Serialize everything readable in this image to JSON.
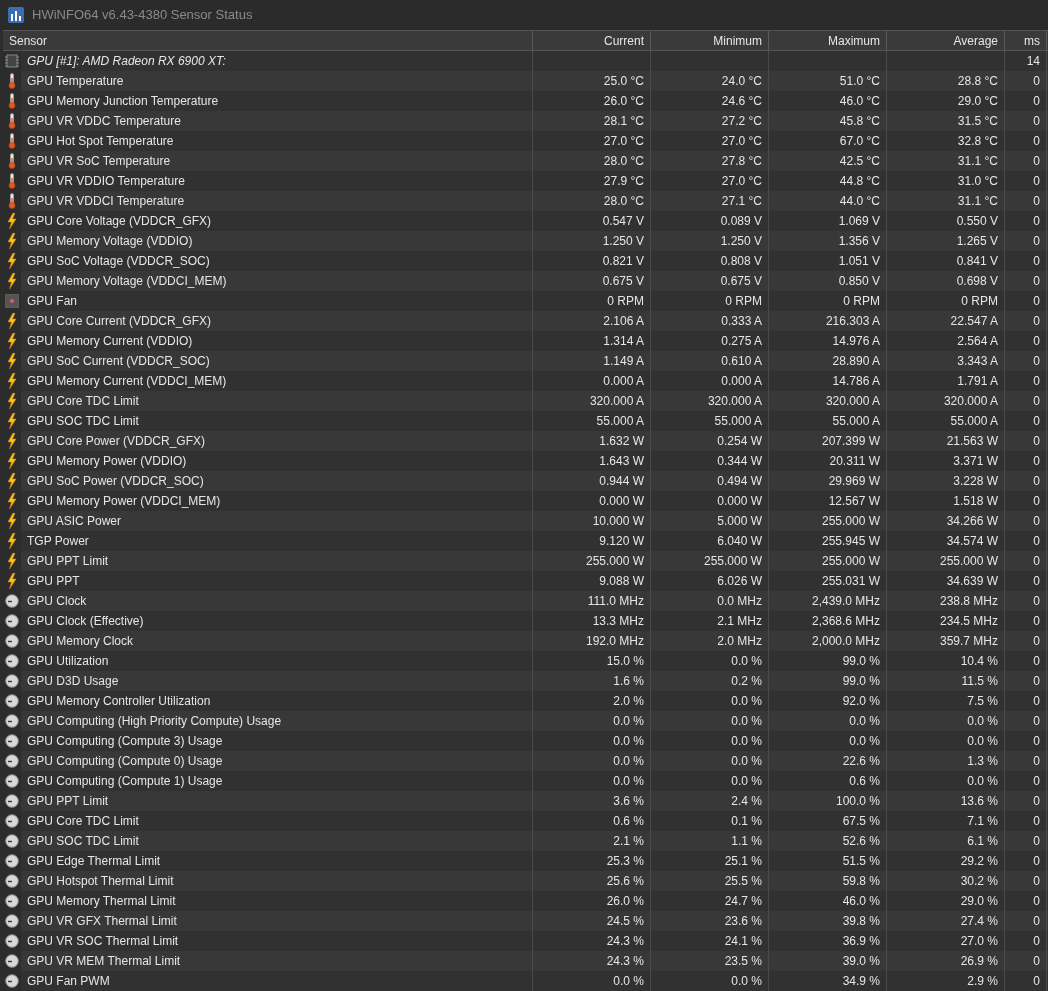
{
  "window": {
    "title": "HWiNFO64 v6.43-4380 Sensor Status"
  },
  "columns": [
    "Sensor",
    "Current",
    "Minimum",
    "Maximum",
    "Average",
    "ms"
  ],
  "rows": [
    {
      "kind": "device",
      "sensor": "GPU [#1]: AMD Radeon RX 6900 XT:",
      "current": "",
      "minimum": "",
      "maximum": "",
      "average": "",
      "ms": "14"
    },
    {
      "kind": "temperature",
      "sensor": "GPU Temperature",
      "current": "25.0 °C",
      "minimum": "24.0 °C",
      "maximum": "51.0 °C",
      "average": "28.8 °C",
      "ms": "0"
    },
    {
      "kind": "temperature",
      "sensor": "GPU Memory Junction Temperature",
      "current": "26.0 °C",
      "minimum": "24.6 °C",
      "maximum": "46.0 °C",
      "average": "29.0 °C",
      "ms": "0"
    },
    {
      "kind": "temperature",
      "sensor": "GPU VR VDDC Temperature",
      "current": "28.1 °C",
      "minimum": "27.2 °C",
      "maximum": "45.8 °C",
      "average": "31.5 °C",
      "ms": "0"
    },
    {
      "kind": "temperature",
      "sensor": "GPU Hot Spot Temperature",
      "current": "27.0 °C",
      "minimum": "27.0 °C",
      "maximum": "67.0 °C",
      "average": "32.8 °C",
      "ms": "0"
    },
    {
      "kind": "temperature",
      "sensor": "GPU VR SoC Temperature",
      "current": "28.0 °C",
      "minimum": "27.8 °C",
      "maximum": "42.5 °C",
      "average": "31.1 °C",
      "ms": "0"
    },
    {
      "kind": "temperature",
      "sensor": "GPU VR VDDIO Temperature",
      "current": "27.9 °C",
      "minimum": "27.0 °C",
      "maximum": "44.8 °C",
      "average": "31.0 °C",
      "ms": "0"
    },
    {
      "kind": "temperature",
      "sensor": "GPU VR VDDCI Temperature",
      "current": "28.0 °C",
      "minimum": "27.1 °C",
      "maximum": "44.0 °C",
      "average": "31.1 °C",
      "ms": "0"
    },
    {
      "kind": "electrical",
      "sensor": "GPU Core Voltage (VDDCR_GFX)",
      "current": "0.547 V",
      "minimum": "0.089 V",
      "maximum": "1.069 V",
      "average": "0.550 V",
      "ms": "0"
    },
    {
      "kind": "electrical",
      "sensor": "GPU Memory Voltage (VDDIO)",
      "current": "1.250 V",
      "minimum": "1.250 V",
      "maximum": "1.356 V",
      "average": "1.265 V",
      "ms": "0"
    },
    {
      "kind": "electrical",
      "sensor": "GPU SoC Voltage (VDDCR_SOC)",
      "current": "0.821 V",
      "minimum": "0.808 V",
      "maximum": "1.051 V",
      "average": "0.841 V",
      "ms": "0"
    },
    {
      "kind": "electrical",
      "sensor": "GPU Memory Voltage (VDDCI_MEM)",
      "current": "0.675 V",
      "minimum": "0.675 V",
      "maximum": "0.850 V",
      "average": "0.698 V",
      "ms": "0"
    },
    {
      "kind": "fan",
      "sensor": "GPU Fan",
      "current": "0 RPM",
      "minimum": "0 RPM",
      "maximum": "0 RPM",
      "average": "0 RPM",
      "ms": "0"
    },
    {
      "kind": "electrical",
      "sensor": "GPU Core Current (VDDCR_GFX)",
      "current": "2.106 A",
      "minimum": "0.333 A",
      "maximum": "216.303 A",
      "average": "22.547 A",
      "ms": "0"
    },
    {
      "kind": "electrical",
      "sensor": "GPU Memory Current (VDDIO)",
      "current": "1.314 A",
      "minimum": "0.275 A",
      "maximum": "14.976 A",
      "average": "2.564 A",
      "ms": "0"
    },
    {
      "kind": "electrical",
      "sensor": "GPU SoC Current (VDDCR_SOC)",
      "current": "1.149 A",
      "minimum": "0.610 A",
      "maximum": "28.890 A",
      "average": "3.343 A",
      "ms": "0"
    },
    {
      "kind": "electrical",
      "sensor": "GPU Memory Current (VDDCI_MEM)",
      "current": "0.000 A",
      "minimum": "0.000 A",
      "maximum": "14.786 A",
      "average": "1.791 A",
      "ms": "0"
    },
    {
      "kind": "electrical",
      "sensor": "GPU Core TDC Limit",
      "current": "320.000 A",
      "minimum": "320.000 A",
      "maximum": "320.000 A",
      "average": "320.000 A",
      "ms": "0"
    },
    {
      "kind": "electrical",
      "sensor": "GPU SOC TDC Limit",
      "current": "55.000 A",
      "minimum": "55.000 A",
      "maximum": "55.000 A",
      "average": "55.000 A",
      "ms": "0"
    },
    {
      "kind": "electrical",
      "sensor": "GPU Core Power (VDDCR_GFX)",
      "current": "1.632 W",
      "minimum": "0.254 W",
      "maximum": "207.399 W",
      "average": "21.563 W",
      "ms": "0"
    },
    {
      "kind": "electrical",
      "sensor": "GPU Memory Power (VDDIO)",
      "current": "1.643 W",
      "minimum": "0.344 W",
      "maximum": "20.311 W",
      "average": "3.371 W",
      "ms": "0"
    },
    {
      "kind": "electrical",
      "sensor": "GPU SoC Power (VDDCR_SOC)",
      "current": "0.944 W",
      "minimum": "0.494 W",
      "maximum": "29.969 W",
      "average": "3.228 W",
      "ms": "0"
    },
    {
      "kind": "electrical",
      "sensor": "GPU Memory Power (VDDCI_MEM)",
      "current": "0.000 W",
      "minimum": "0.000 W",
      "maximum": "12.567 W",
      "average": "1.518 W",
      "ms": "0"
    },
    {
      "kind": "electrical",
      "sensor": "GPU ASIC Power",
      "current": "10.000 W",
      "minimum": "5.000 W",
      "maximum": "255.000 W",
      "average": "34.266 W",
      "ms": "0"
    },
    {
      "kind": "electrical",
      "sensor": "TGP Power",
      "current": "9.120 W",
      "minimum": "6.040 W",
      "maximum": "255.945 W",
      "average": "34.574 W",
      "ms": "0"
    },
    {
      "kind": "electrical",
      "sensor": "GPU PPT Limit",
      "current": "255.000 W",
      "minimum": "255.000 W",
      "maximum": "255.000 W",
      "average": "255.000 W",
      "ms": "0"
    },
    {
      "kind": "electrical",
      "sensor": "GPU PPT",
      "current": "9.088 W",
      "minimum": "6.026 W",
      "maximum": "255.031 W",
      "average": "34.639 W",
      "ms": "0"
    },
    {
      "kind": "gauge",
      "sensor": "GPU Clock",
      "current": "111.0 MHz",
      "minimum": "0.0 MHz",
      "maximum": "2,439.0 MHz",
      "average": "238.8 MHz",
      "ms": "0"
    },
    {
      "kind": "gauge",
      "sensor": "GPU Clock (Effective)",
      "current": "13.3 MHz",
      "minimum": "2.1 MHz",
      "maximum": "2,368.6 MHz",
      "average": "234.5 MHz",
      "ms": "0"
    },
    {
      "kind": "gauge",
      "sensor": "GPU Memory Clock",
      "current": "192.0 MHz",
      "minimum": "2.0 MHz",
      "maximum": "2,000.0 MHz",
      "average": "359.7 MHz",
      "ms": "0"
    },
    {
      "kind": "gauge",
      "sensor": "GPU Utilization",
      "current": "15.0 %",
      "minimum": "0.0 %",
      "maximum": "99.0 %",
      "average": "10.4 %",
      "ms": "0"
    },
    {
      "kind": "gauge",
      "sensor": "GPU D3D Usage",
      "current": "1.6 %",
      "minimum": "0.2 %",
      "maximum": "99.0 %",
      "average": "11.5 %",
      "ms": "0"
    },
    {
      "kind": "gauge",
      "sensor": "GPU Memory Controller Utilization",
      "current": "2.0 %",
      "minimum": "0.0 %",
      "maximum": "92.0 %",
      "average": "7.5 %",
      "ms": "0"
    },
    {
      "kind": "gauge",
      "sensor": "GPU Computing (High Priority Compute) Usage",
      "current": "0.0 %",
      "minimum": "0.0 %",
      "maximum": "0.0 %",
      "average": "0.0 %",
      "ms": "0"
    },
    {
      "kind": "gauge",
      "sensor": "GPU Computing (Compute 3) Usage",
      "current": "0.0 %",
      "minimum": "0.0 %",
      "maximum": "0.0 %",
      "average": "0.0 %",
      "ms": "0"
    },
    {
      "kind": "gauge",
      "sensor": "GPU Computing (Compute 0) Usage",
      "current": "0.0 %",
      "minimum": "0.0 %",
      "maximum": "22.6 %",
      "average": "1.3 %",
      "ms": "0"
    },
    {
      "kind": "gauge",
      "sensor": "GPU Computing (Compute 1) Usage",
      "current": "0.0 %",
      "minimum": "0.0 %",
      "maximum": "0.6 %",
      "average": "0.0 %",
      "ms": "0"
    },
    {
      "kind": "gauge",
      "sensor": "GPU PPT Limit",
      "current": "3.6 %",
      "minimum": "2.4 %",
      "maximum": "100.0 %",
      "average": "13.6 %",
      "ms": "0"
    },
    {
      "kind": "gauge",
      "sensor": "GPU Core TDC Limit",
      "current": "0.6 %",
      "minimum": "0.1 %",
      "maximum": "67.5 %",
      "average": "7.1 %",
      "ms": "0"
    },
    {
      "kind": "gauge",
      "sensor": "GPU SOC TDC Limit",
      "current": "2.1 %",
      "minimum": "1.1 %",
      "maximum": "52.6 %",
      "average": "6.1 %",
      "ms": "0"
    },
    {
      "kind": "gauge",
      "sensor": "GPU Edge Thermal Limit",
      "current": "25.3 %",
      "minimum": "25.1 %",
      "maximum": "51.5 %",
      "average": "29.2 %",
      "ms": "0"
    },
    {
      "kind": "gauge",
      "sensor": "GPU Hotspot Thermal Limit",
      "current": "25.6 %",
      "minimum": "25.5 %",
      "maximum": "59.8 %",
      "average": "30.2 %",
      "ms": "0"
    },
    {
      "kind": "gauge",
      "sensor": "GPU Memory Thermal Limit",
      "current": "26.0 %",
      "minimum": "24.7 %",
      "maximum": "46.0 %",
      "average": "29.0 %",
      "ms": "0"
    },
    {
      "kind": "gauge",
      "sensor": "GPU VR GFX Thermal Limit",
      "current": "24.5 %",
      "minimum": "23.6 %",
      "maximum": "39.8 %",
      "average": "27.4 %",
      "ms": "0"
    },
    {
      "kind": "gauge",
      "sensor": "GPU VR SOC Thermal Limit",
      "current": "24.3 %",
      "minimum": "24.1 %",
      "maximum": "36.9 %",
      "average": "27.0 %",
      "ms": "0"
    },
    {
      "kind": "gauge",
      "sensor": "GPU VR MEM Thermal Limit",
      "current": "24.3 %",
      "minimum": "23.5 %",
      "maximum": "39.0 %",
      "average": "26.9 %",
      "ms": "0"
    },
    {
      "kind": "gauge",
      "sensor": "GPU Fan PWM",
      "current": "0.0 %",
      "minimum": "0.0 %",
      "maximum": "34.9 %",
      "average": "2.9 %",
      "ms": "0"
    }
  ]
}
